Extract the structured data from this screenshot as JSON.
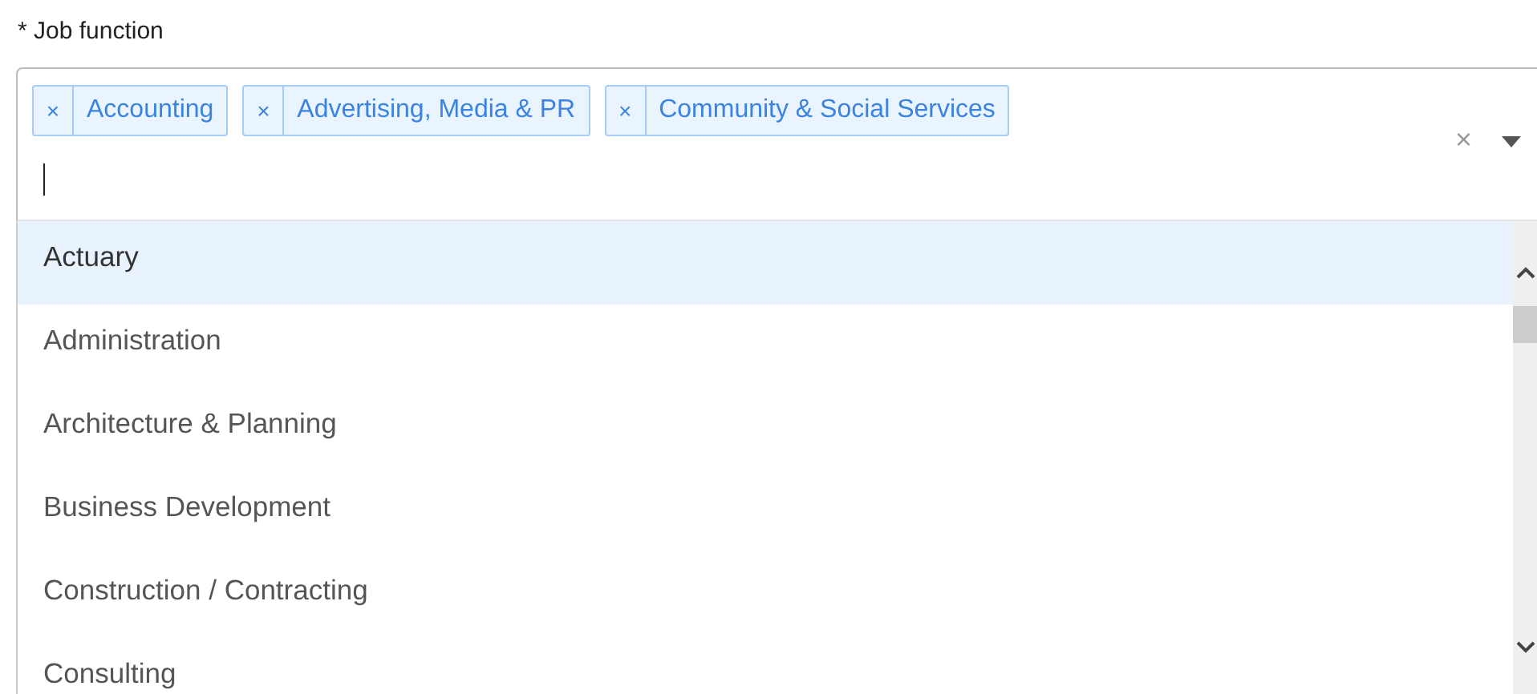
{
  "field": {
    "label": "* Job function",
    "clear": "×",
    "tags": [
      {
        "remove": "×",
        "label": "Accounting"
      },
      {
        "remove": "×",
        "label": "Advertising, Media & PR"
      },
      {
        "remove": "×",
        "label": "Community & Social Services"
      }
    ]
  },
  "options": [
    {
      "label": "Actuary",
      "selected": true
    },
    {
      "label": "Administration",
      "selected": false
    },
    {
      "label": "Architecture & Planning",
      "selected": false
    },
    {
      "label": "Business Development",
      "selected": false
    },
    {
      "label": "Construction / Contracting",
      "selected": false
    },
    {
      "label": "Consulting",
      "selected": false
    }
  ]
}
